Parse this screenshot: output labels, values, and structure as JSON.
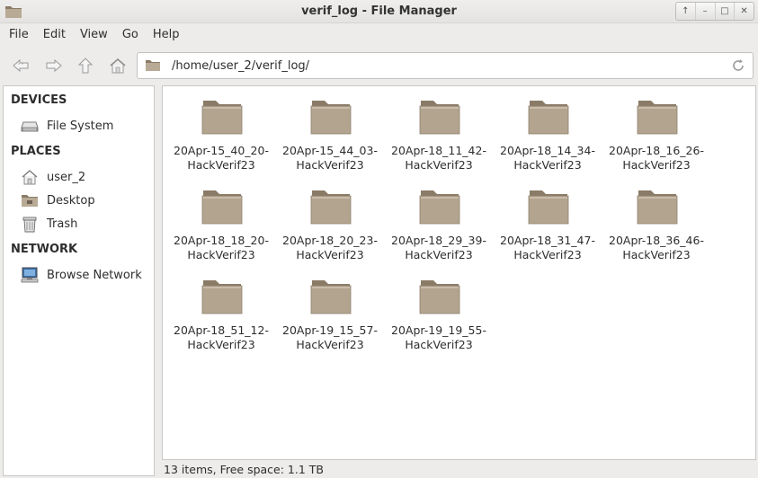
{
  "window": {
    "title": "verif_log - File Manager",
    "buttons": [
      "↑",
      "–",
      "□",
      "✕"
    ]
  },
  "menu": [
    "File",
    "Edit",
    "View",
    "Go",
    "Help"
  ],
  "toolbar": {
    "back_icon": "back-arrow-icon",
    "forward_icon": "forward-arrow-icon",
    "up_icon": "up-arrow-icon",
    "home_icon": "home-icon"
  },
  "location": {
    "path": "/home/user_2/verif_log/"
  },
  "sidebar": {
    "devices_header": "DEVICES",
    "devices": [
      {
        "label": "File System",
        "icon": "drive-icon"
      }
    ],
    "places_header": "PLACES",
    "places": [
      {
        "label": "user_2",
        "icon": "home-icon"
      },
      {
        "label": "Desktop",
        "icon": "desktop-icon"
      },
      {
        "label": "Trash",
        "icon": "trash-icon"
      }
    ],
    "network_header": "NETWORK",
    "network": [
      {
        "label": "Browse Network",
        "icon": "network-icon"
      }
    ]
  },
  "folders": [
    {
      "line1": "20Apr-15_40_20-",
      "line2": "HackVerif23"
    },
    {
      "line1": "20Apr-15_44_03-",
      "line2": "HackVerif23"
    },
    {
      "line1": "20Apr-18_11_42-",
      "line2": "HackVerif23"
    },
    {
      "line1": "20Apr-18_14_34-",
      "line2": "HackVerif23"
    },
    {
      "line1": "20Apr-18_16_26-",
      "line2": "HackVerif23"
    },
    {
      "line1": "20Apr-18_18_20-",
      "line2": "HackVerif23"
    },
    {
      "line1": "20Apr-18_20_23-",
      "line2": "HackVerif23"
    },
    {
      "line1": "20Apr-18_29_39-",
      "line2": "HackVerif23"
    },
    {
      "line1": "20Apr-18_31_47-",
      "line2": "HackVerif23"
    },
    {
      "line1": "20Apr-18_36_46-",
      "line2": "HackVerif23"
    },
    {
      "line1": "20Apr-18_51_12-",
      "line2": "HackVerif23"
    },
    {
      "line1": "20Apr-19_15_57-",
      "line2": "HackVerif23"
    },
    {
      "line1": "20Apr-19_19_55-",
      "line2": "HackVerif23"
    }
  ],
  "status": {
    "text": "13 items, Free space: 1.1 TB"
  },
  "colors": {
    "folder_body": "#b3a48f",
    "folder_tab": "#8a7b66"
  }
}
